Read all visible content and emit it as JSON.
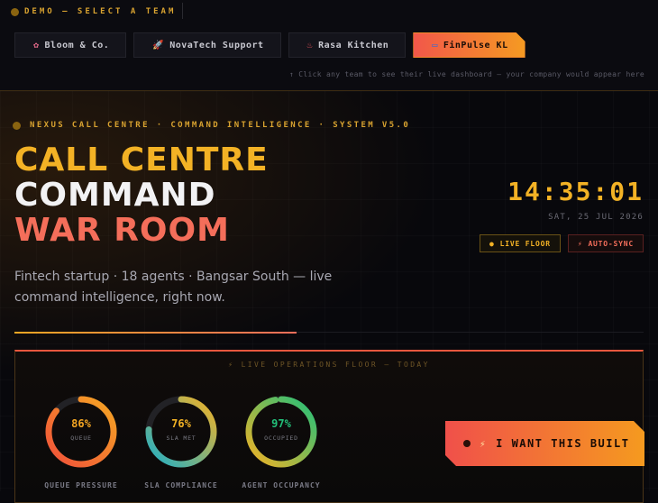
{
  "demo": {
    "label": "DEMO — SELECT A TEAM"
  },
  "teams": [
    {
      "icon": "✿",
      "label": "Bloom & Co.",
      "active": false
    },
    {
      "icon": "🚀",
      "label": "NovaTech Support",
      "active": false
    },
    {
      "icon": "♨",
      "label": "Rasa Kitchen",
      "active": false
    },
    {
      "icon": "▭",
      "label": "FinPulse KL",
      "active": true
    }
  ],
  "hint": "↑ Click any team to see their live dashboard — your company would appear here",
  "system_label": "NEXUS CALL CENTRE · COMMAND INTELLIGENCE · SYSTEM V5.0",
  "title": {
    "line1": "CALL CENTRE",
    "line2": "COMMAND",
    "line3": "WAR ROOM"
  },
  "subtitle": "Fintech startup · 18 agents · Bangsar South — live command intelligence, right now.",
  "clock": {
    "time": "14:35:01",
    "date": "SAT, 25 JUL 2026"
  },
  "badges": {
    "live": "LIVE FLOOR",
    "sync": "AUTO-SYNC",
    "live_icon": "●",
    "sync_icon": "⚡"
  },
  "ops": {
    "label": "⚡ LIVE OPERATIONS FLOOR — TODAY",
    "gauges": [
      {
        "value": "86%",
        "fraction": 0.86,
        "sub": "QUEUE",
        "caption": "QUEUE PRESSURE",
        "color": "#f5a623",
        "color2": "#f0503a"
      },
      {
        "value": "76%",
        "fraction": 0.76,
        "sub": "SLA MET",
        "caption": "SLA COMPLIANCE",
        "color": "#f3b225",
        "color2": "#1fb0c8"
      },
      {
        "value": "97%",
        "fraction": 0.97,
        "sub": "OCCUPIED",
        "caption": "AGENT OCCUPANCY",
        "color": "#22c07a",
        "color2": "#f3b225"
      }
    ]
  },
  "cta": {
    "label": "I WANT THIS BUILT",
    "icon": "⚡"
  }
}
